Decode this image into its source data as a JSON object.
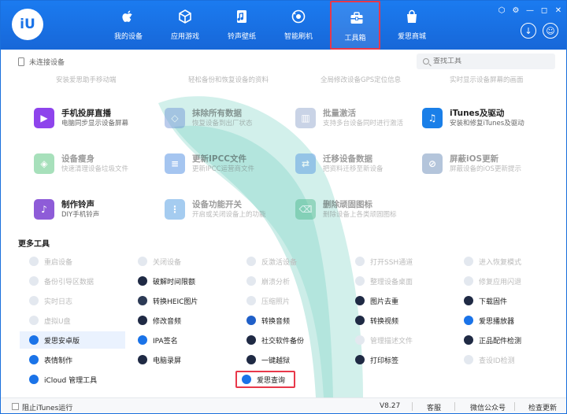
{
  "app": {
    "logo_text": "iU"
  },
  "window_controls": [
    "⬡",
    "⚙",
    "—",
    "◻",
    "✕"
  ],
  "nav": [
    {
      "label": "我的设备",
      "icon": "apple-icon"
    },
    {
      "label": "应用游戏",
      "icon": "cube-icon"
    },
    {
      "label": "铃声壁纸",
      "icon": "music-file-icon"
    },
    {
      "label": "智能刷机",
      "icon": "refresh-gear-icon"
    },
    {
      "label": "工具箱",
      "icon": "toolbox-icon",
      "active": true
    },
    {
      "label": "爱思商城",
      "icon": "shopping-bag-icon"
    }
  ],
  "subbar": {
    "device_status": "未连接设备",
    "search_placeholder": "查找工具"
  },
  "top_partial": [
    {
      "desc": "安装爱思助手移动端"
    },
    {
      "desc": "轻松备份和恢复设备的资料"
    },
    {
      "desc": "全局修改设备GPS定位信息"
    },
    {
      "desc": "实时显示设备屏幕的画面"
    }
  ],
  "tools": [
    {
      "name": "手机投屏直播",
      "desc": "电脑同步显示设备屏幕",
      "color": "#8e44ec",
      "glyph": "▶",
      "dim": false
    },
    {
      "name": "抹除所有数据",
      "desc": "恢复设备到出厂状态",
      "color": "#6b8fd6",
      "glyph": "◇",
      "dim": true
    },
    {
      "name": "批量激活",
      "desc": "支持多台设备同时进行激活",
      "color": "#8aa0c8",
      "glyph": "▥",
      "dim": true
    },
    {
      "name": "iTunes及驱动",
      "desc": "安装和修复iTunes及驱动",
      "color": "#1a7fe8",
      "glyph": "♫",
      "dim": false
    },
    {
      "name": "设备瘦身",
      "desc": "快速清理设备垃圾文件",
      "color": "#3dbb6b",
      "glyph": "◈",
      "dim": true
    },
    {
      "name": "更新IPCC文件",
      "desc": "更新IPCC运营商文件",
      "color": "#3a7fe0",
      "glyph": "≡",
      "dim": true
    },
    {
      "name": "迁移设备数据",
      "desc": "把资料迁移至新设备",
      "color": "#4a90e2",
      "glyph": "⇄",
      "dim": true
    },
    {
      "name": "屏蔽iOS更新",
      "desc": "屏蔽设备的iOS更新提示",
      "color": "#5a7fb0",
      "glyph": "⊘",
      "dim": true
    },
    {
      "name": "制作铃声",
      "desc": "DIY手机铃声",
      "color": "#8e5cd8",
      "glyph": "♪",
      "dim": false
    },
    {
      "name": "设备功能开关",
      "desc": "开启或关闭设备上的功能",
      "color": "#3a8fe0",
      "glyph": "⋮",
      "dim": true
    },
    {
      "name": "删除顽固图标",
      "desc": "删除设备上各类顽固图标",
      "color": "#4ab88a",
      "glyph": "⌫",
      "dim": true
    }
  ],
  "more_section_title": "更多工具",
  "more_tools": [
    [
      "重启设备",
      "关闭设备",
      "反激活设备",
      "打开SSH通道",
      "进入恢复模式"
    ],
    [
      "备份引导区数据",
      "破解时间限额",
      "崩溃分析",
      "整理设备桌面",
      "修复应用闪退"
    ],
    [
      "实时日志",
      "转换HEIC图片",
      "压缩照片",
      "图片去重",
      "下载固件"
    ],
    [
      "虚拟U盘",
      "修改音频",
      "转换音频",
      "转换视频",
      "爱思播放器"
    ],
    [
      "爱思安卓版",
      "IPA签名",
      "社交软件备份",
      "管理描述文件",
      "正品配件检测"
    ],
    [
      "表情制作",
      "电脑录屏",
      "一键越狱",
      "打印标签",
      "查设ID检测"
    ],
    [
      "iCloud 管理工具",
      "爱思查询"
    ]
  ],
  "more_enabled": [
    [
      false,
      false,
      false,
      false,
      false
    ],
    [
      false,
      true,
      false,
      false,
      false
    ],
    [
      false,
      true,
      false,
      true,
      true
    ],
    [
      false,
      true,
      true,
      true,
      true
    ],
    [
      true,
      true,
      true,
      false,
      true
    ],
    [
      true,
      true,
      true,
      true,
      false
    ],
    [
      true,
      true
    ]
  ],
  "more_colors": [
    [
      "#d9d9d9",
      "#d9d9d9",
      "#d9d9d9",
      "#d9d9d9",
      "#d9d9d9"
    ],
    [
      "#d9d9d9",
      "#1f2a44",
      "#d9d9d9",
      "#d9d9d9",
      "#d9d9d9"
    ],
    [
      "#d9d9d9",
      "#2c3a55",
      "#d9d9d9",
      "#1f2a44",
      "#1f2a44"
    ],
    [
      "#d9d9d9",
      "#1f2a44",
      "#1f5fc8",
      "#1f2a44",
      "#1a73e8"
    ],
    [
      "#1a73e8",
      "#1a73e8",
      "#1f2a44",
      "#d9d9d9",
      "#1f2a44"
    ],
    [
      "#1a73e8",
      "#1f2a44",
      "#1f2a44",
      "#1f2a44",
      "#d9d9d9"
    ],
    [
      "#1a73e8",
      "#1a73e8"
    ]
  ],
  "status": {
    "stop_itunes": "阻止iTunes运行",
    "version": "V8.27",
    "feedback": "客服",
    "wechat": "微信公众号",
    "update": "检查更新"
  }
}
